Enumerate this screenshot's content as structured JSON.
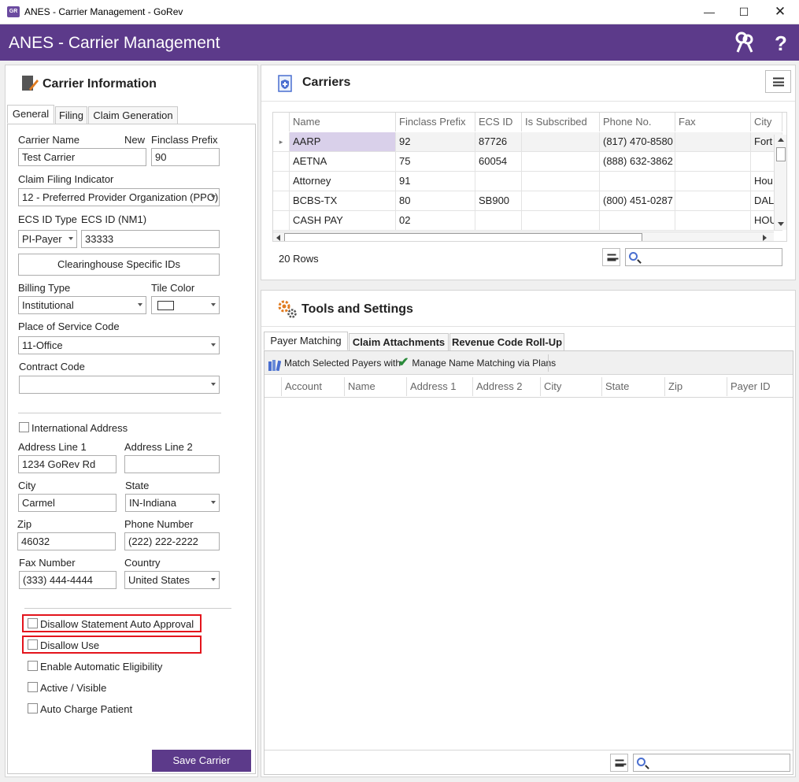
{
  "window": {
    "title": "ANES - Carrier Management - GoRev",
    "app_icon": "GR"
  },
  "header": {
    "title": "ANES - Carrier Management",
    "help": "?"
  },
  "carrier_info": {
    "title": "Carrier Information",
    "tabs": [
      "General",
      "Filing",
      "Claim Generation"
    ],
    "carrier_name_label": "Carrier Name",
    "carrier_name": "Test Carrier",
    "new_label": "New",
    "finclass_label": "Finclass Prefix",
    "finclass": "90",
    "claim_filing_label": "Claim Filing Indicator",
    "claim_filing": "12 - Preferred Provider Organization (PPO)",
    "ecs_type_label": "ECS ID Type",
    "ecs_type": "PI-Payer",
    "ecs_id_label": "ECS ID (NM1)",
    "ecs_id": "33333",
    "clearinghouse_button": "Clearinghouse Specific IDs",
    "billing_type_label": "Billing Type",
    "billing_type": "Institutional",
    "tile_color_label": "Tile Color",
    "pos_label": "Place of Service Code",
    "pos": "11-Office",
    "contract_label": "Contract Code",
    "contract": "",
    "intl_label": "International Address",
    "addr1_label": "Address Line 1",
    "addr1": "1234 GoRev Rd",
    "addr2_label": "Address Line 2",
    "addr2": "",
    "city_label": "City",
    "city": "Carmel",
    "state_label": "State",
    "state": "IN-Indiana",
    "zip_label": "Zip",
    "zip": "46032",
    "phone_label": "Phone Number",
    "phone": "(222) 222-2222",
    "fax_label": "Fax Number",
    "fax": "(333) 444-4444",
    "country_label": "Country",
    "country": "United States",
    "checks": [
      "Disallow Statement Auto Approval",
      "Disallow Use",
      "Enable Automatic Eligibility",
      "Active / Visible",
      "Auto Charge Patient"
    ],
    "save_button": "Save Carrier"
  },
  "carriers": {
    "title": "Carriers",
    "columns": [
      "Name",
      "Finclass Prefix",
      "ECS ID",
      "Is Subscribed",
      "Phone No.",
      "Fax",
      "City"
    ],
    "rows": [
      [
        "AARP",
        "92",
        "87726",
        "",
        "(817) 470-8580",
        "",
        "Fort"
      ],
      [
        "AETNA",
        "75",
        "60054",
        "",
        "(888) 632-3862",
        "",
        ""
      ],
      [
        "Attorney",
        "91",
        "",
        "",
        "",
        "",
        "Hou"
      ],
      [
        "BCBS-TX",
        "80",
        "SB900",
        "",
        "(800) 451-0287",
        "",
        "DAL"
      ],
      [
        "CASH PAY",
        "02",
        "",
        "",
        "",
        "",
        "HOU"
      ]
    ],
    "row_count": "20 Rows"
  },
  "tools": {
    "title": "Tools and Settings",
    "tabs": [
      "Payer Matching",
      "Claim Attachments",
      "Revenue Code Roll-Up"
    ],
    "match_btn": "Match Selected Payers with",
    "manage_btn": "Manage Name Matching via Plans",
    "columns": [
      "Account",
      "Name",
      "Address 1",
      "Address 2",
      "City",
      "State",
      "Zip",
      "Payer ID"
    ]
  },
  "colors": {
    "brand": "#5c3a8a",
    "highlight": "#e3141c"
  }
}
